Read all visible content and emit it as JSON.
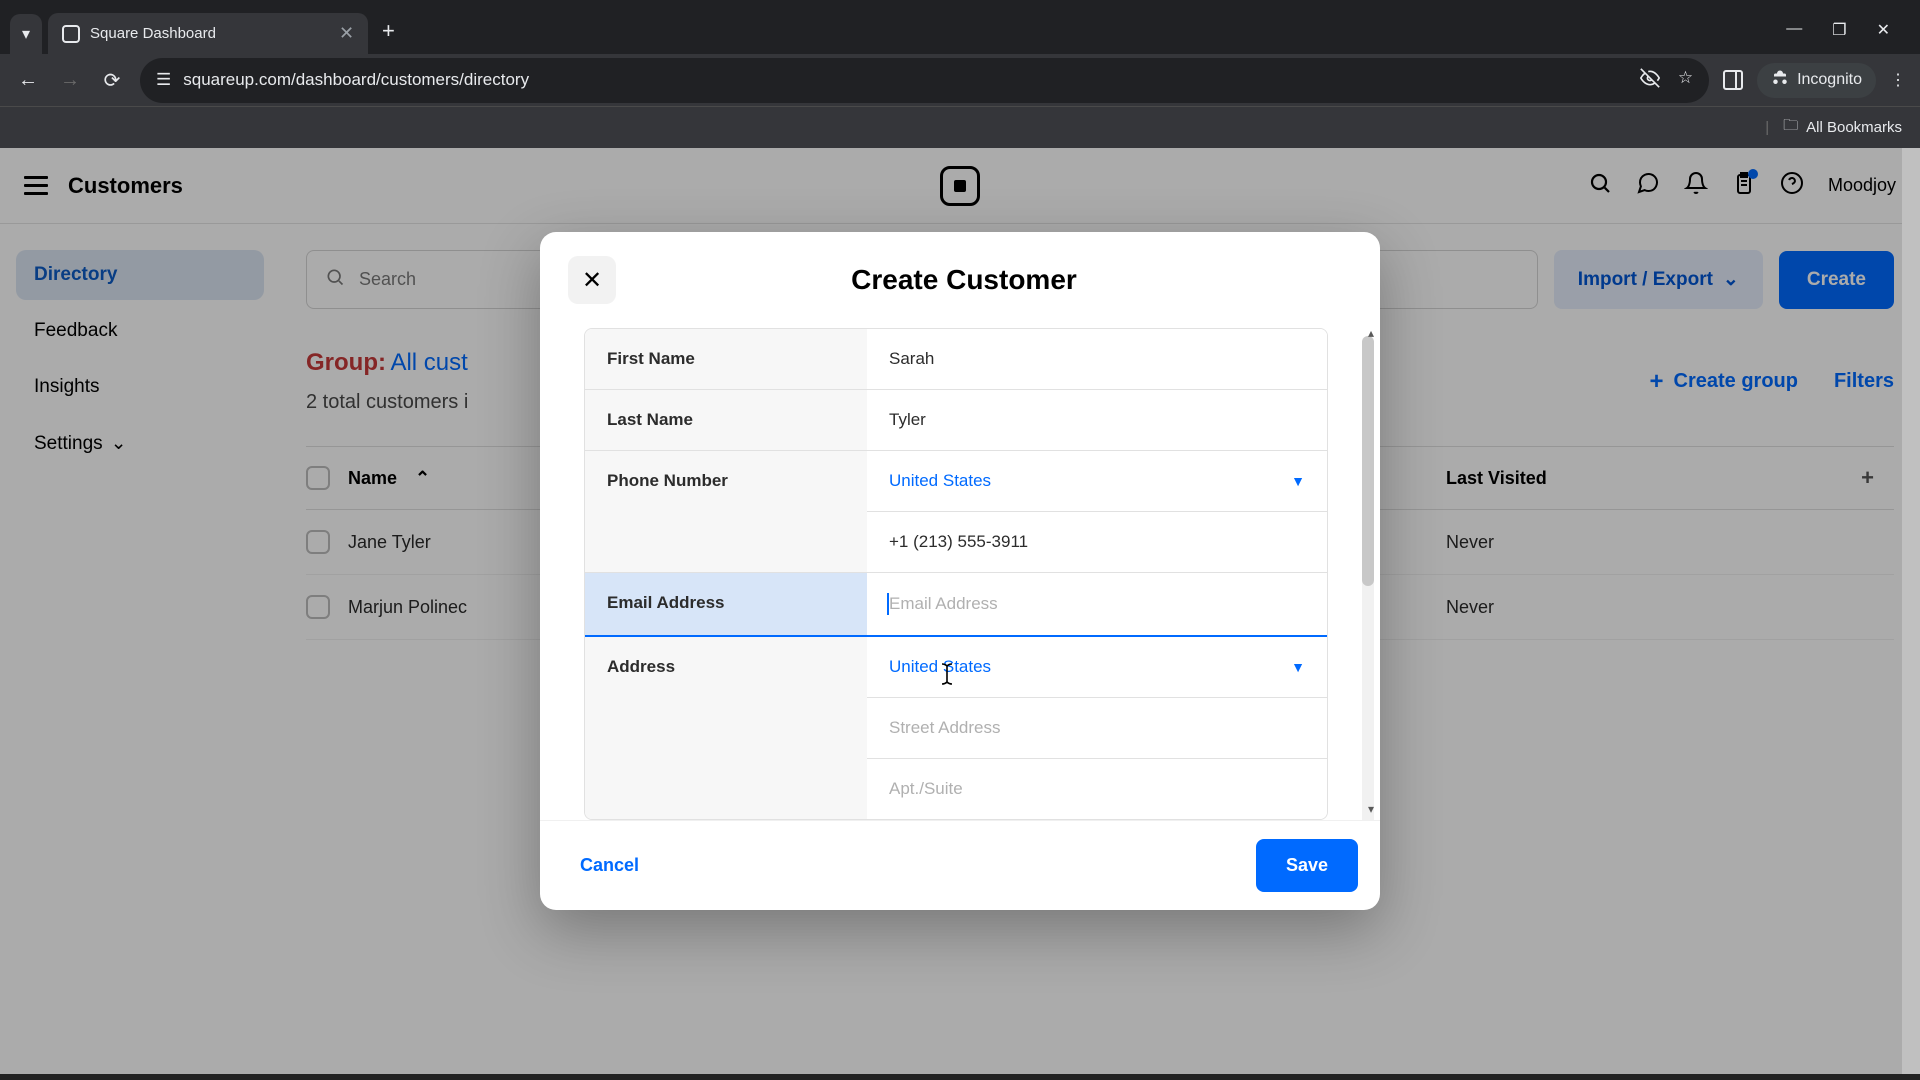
{
  "browser": {
    "tab_title": "Square Dashboard",
    "url": "squareup.com/dashboard/customers/directory",
    "incognito_label": "Incognito",
    "all_bookmarks": "All Bookmarks"
  },
  "header": {
    "title": "Customers",
    "user": "Moodjoy"
  },
  "sidebar": {
    "items": [
      {
        "label": "Directory",
        "active": true
      },
      {
        "label": "Feedback",
        "active": false
      },
      {
        "label": "Insights",
        "active": false
      },
      {
        "label": "Settings",
        "active": false,
        "chevron": true
      }
    ]
  },
  "main": {
    "search_placeholder": "Search",
    "import_export": "Import / Export",
    "create": "Create",
    "group_label": "Group:",
    "group_value": "All cust",
    "count_line": "2 total customers i",
    "create_group": "Create group",
    "filters": "Filters",
    "columns": {
      "name": "Name",
      "last_visited": "Last Visited"
    },
    "rows": [
      {
        "name": "Jane Tyler",
        "last_visited": "Never"
      },
      {
        "name": "Marjun Polinec",
        "last_visited": "Never"
      }
    ]
  },
  "modal": {
    "title": "Create Customer",
    "fields": {
      "first_name": {
        "label": "First Name",
        "value": "Sarah"
      },
      "last_name": {
        "label": "Last Name",
        "value": "Tyler"
      },
      "phone": {
        "label": "Phone Number",
        "country": "United States",
        "value": "+1 (213) 555-3911"
      },
      "email": {
        "label": "Email Address",
        "placeholder": "Email Address",
        "value": ""
      },
      "address": {
        "label": "Address",
        "country": "United States",
        "street_placeholder": "Street Address",
        "apt_placeholder": "Apt./Suite"
      }
    },
    "cancel": "Cancel",
    "save": "Save"
  }
}
